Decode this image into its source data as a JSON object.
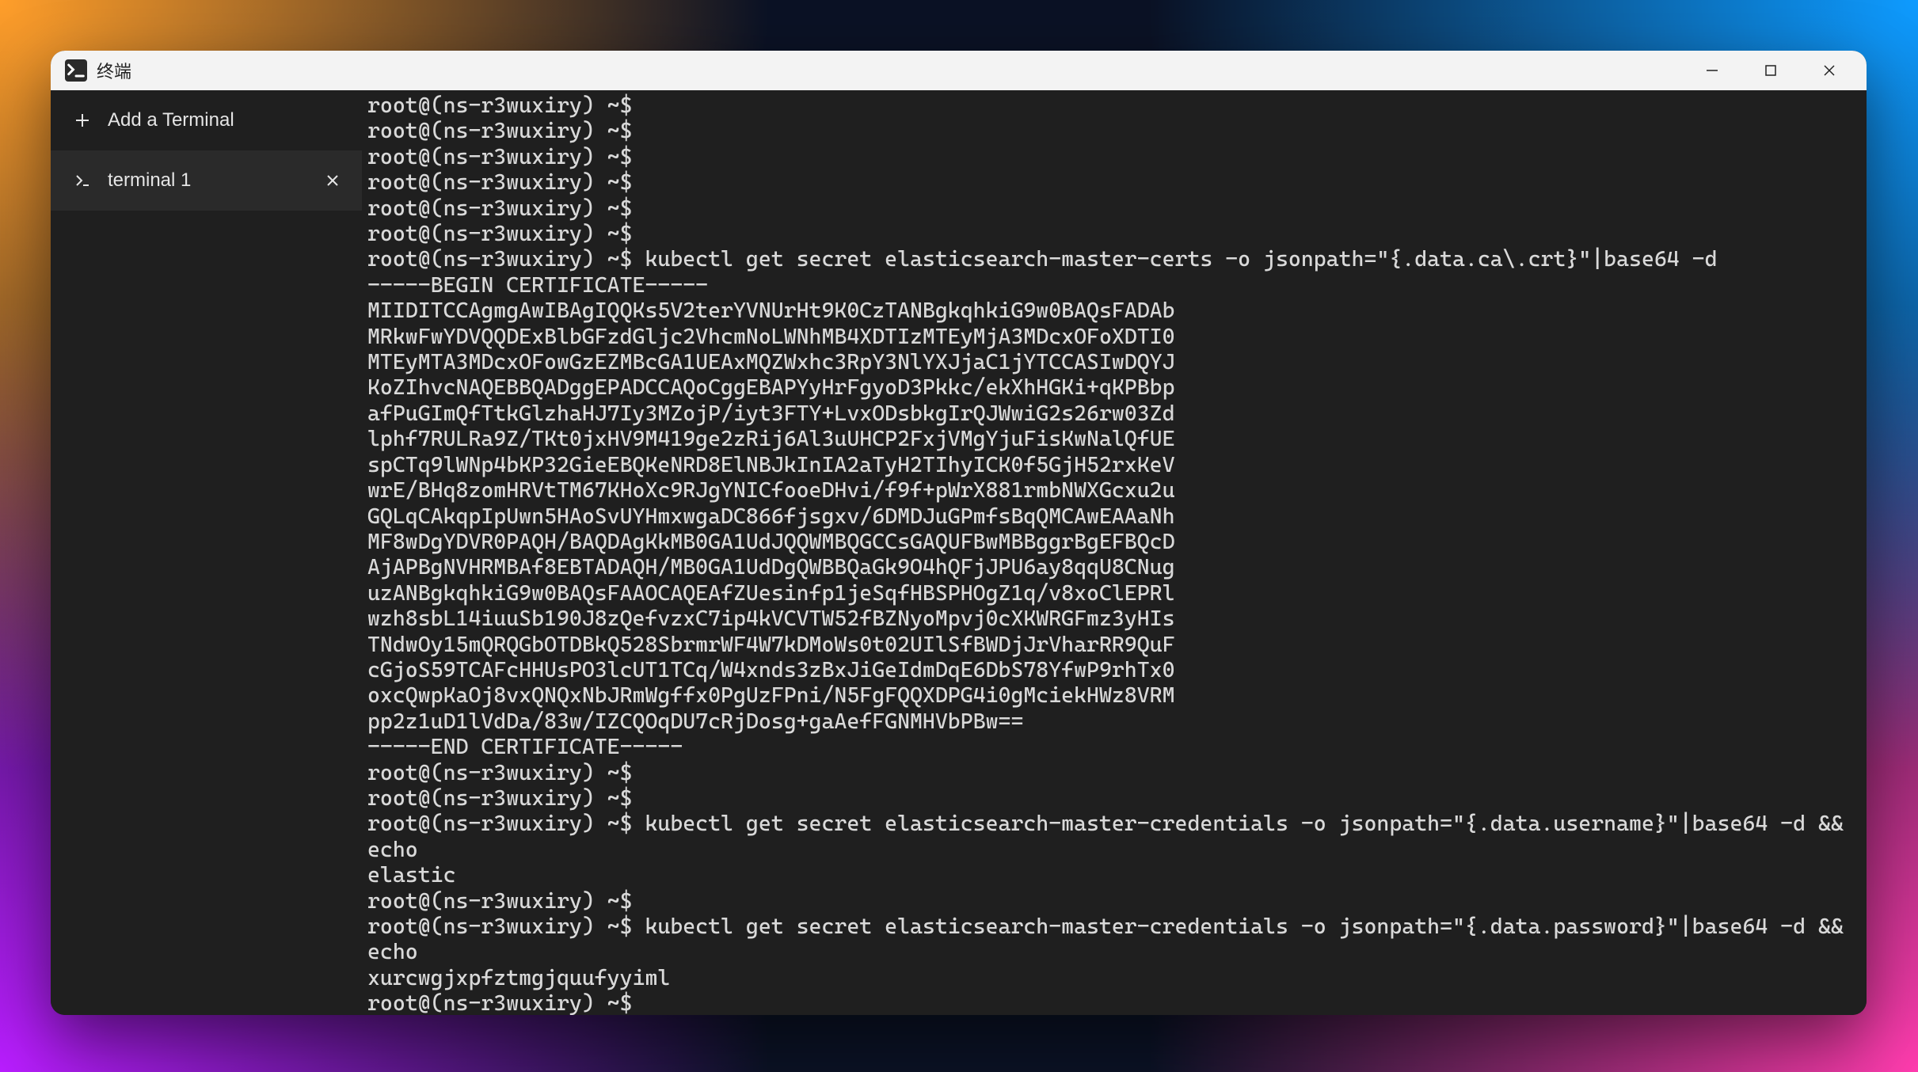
{
  "window": {
    "title": "终端"
  },
  "sidebar": {
    "add_label": "Add a Terminal",
    "tab_label": "terminal 1"
  },
  "terminal": {
    "prompt": "root@(ns-r3wuxiry) ~$",
    "cmd_cert": "kubectl get secret elasticsearch-master-certs -o jsonpath=\"{.data.ca\\.crt}\"|base64 -d",
    "cert_begin": "-----BEGIN CERTIFICATE-----",
    "cert_lines": [
      "MIIDITCCAgmgAwIBAgIQQKs5V2terYVNUrHt9K0CzTANBgkqhkiG9w0BAQsFADAb",
      "MRkwFwYDVQQDExBlbGFzdGljc2VhcmNoLWNhMB4XDTIzMTEyMjA3MDcxOFoXDTI0",
      "MTEyMTA3MDcxOFowGzEZMBcGA1UEAxMQZWxhc3RpY3NlYXJjaC1jYTCCASIwDQYJ",
      "KoZIhvcNAQEBBQADggEPADCCAQoCggEBAPYyHrFgyoD3Pkkc/ekXhHGKi+qKPBbp",
      "afPuGImQfTtkGlzhaHJ7Iy3MZojP/iyt3FTY+LvxODsbkgIrQJWwiG2s26rw03Zd",
      "lphf7RULRa9Z/TKt0jxHV9M419ge2zRij6Al3uUHCP2FxjVMgYjuFisKwNalQfUE",
      "spCTq9lWNp4bKP32GieEBQKeNRD8ElNBJkInIA2aTyH2TIhyICK0f5GjH52rxKeV",
      "wrE/BHq8zomHRVtTM67KHoXc9RJgYNICfooeDHvi/f9f+pWrX881rmbNWXGcxu2u",
      "GQLqCAkqpIpUwn5HAoSvUYHmxwgaDC866fjsgxv/6DMDJuGPmfsBqQMCAwEAAaNh",
      "MF8wDgYDVR0PAQH/BAQDAgKkMB0GA1UdJQQWMBQGCCsGAQUFBwMBBggrBgEFBQcD",
      "AjAPBgNVHRMBAf8EBTADAQH/MB0GA1UdDgQWBBQaGk9O4hQFjJPU6ay8qqU8CNug",
      "uzANBgkqhkiG9w0BAQsFAAOCAQEAfZUesinfp1jeSqfHBSPHOgZ1q/v8xoClEPRl",
      "wzh8sbL14iuuSb190J8zQefvzxC7ip4kVCVTW52fBZNyoMpvj0cXKWRGFmz3yHIs",
      "TNdwOy15mQRQGbOTDBkQ528SbrmrWF4W7kDMoWs0t02UIlSfBWDjJrVharRR9QuF",
      "cGjoS59TCAFcHHUsPO3lcUT1TCq/W4xnds3zBxJiGeIdmDqE6DbS78YfwP9rhTx0",
      "oxcQwpKaOj8vxQNQxNbJRmWgffx0PgUzFPni/N5FgFQQXDPG4i0gMciekHWz8VRM",
      "pp2z1uD1lVdDa/83w/IZCQOqDU7cRjDosg+gaAefFGNMHVbPBw=="
    ],
    "cert_end": "-----END CERTIFICATE-----",
    "cmd_user": "kubectl get secret elasticsearch-master-credentials -o jsonpath=\"{.data.username}\"|base64 -d && echo",
    "out_user": "elastic",
    "cmd_pass": "kubectl get secret elasticsearch-master-credentials -o jsonpath=\"{.data.password}\"|base64 -d && echo",
    "out_pass": "xurcwgjxpfztmgjquufyyiml"
  }
}
